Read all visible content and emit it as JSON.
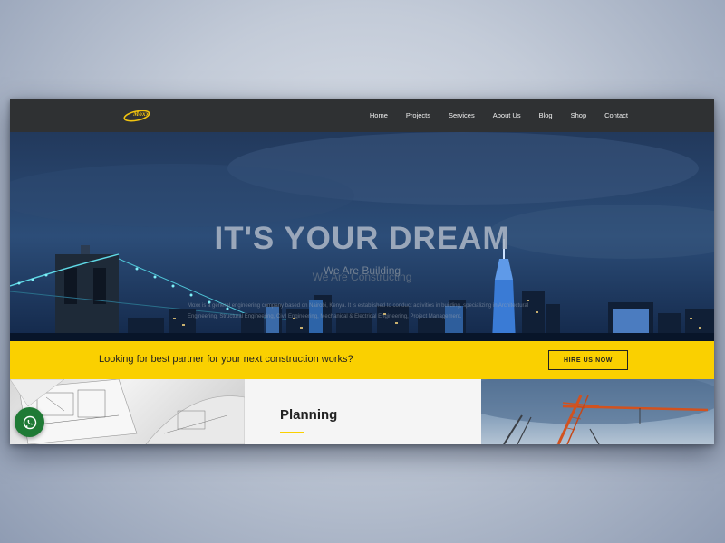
{
  "brand": {
    "logo_text": "Moxx"
  },
  "nav": {
    "items": [
      {
        "label": "Home"
      },
      {
        "label": "Projects"
      },
      {
        "label": "Services"
      },
      {
        "label": "About Us"
      },
      {
        "label": "Blog"
      },
      {
        "label": "Shop"
      },
      {
        "label": "Contact"
      }
    ]
  },
  "hero": {
    "title": "IT'S YOUR DREAM",
    "subtitle_1": "We Are Building",
    "subtitle_2": "We Are Constructing",
    "description": "Moxx is a general engineering company based on Nairobi, Kenya. It is established to conduct activities in building, specializing in Architectural Engineering, Structural Engineering, Civil Engineering, Mechanical & Electrical Engineering, Project Management."
  },
  "cta": {
    "text": "Looking for best partner for your next construction works?",
    "button_label": "HIRE US NOW"
  },
  "services": {
    "planning_title": "Planning"
  },
  "colors": {
    "accent": "#fad000",
    "nav_bg": "#2f3133",
    "whatsapp": "#1f7a35"
  },
  "icons": {
    "whatsapp": "whatsapp-icon"
  }
}
